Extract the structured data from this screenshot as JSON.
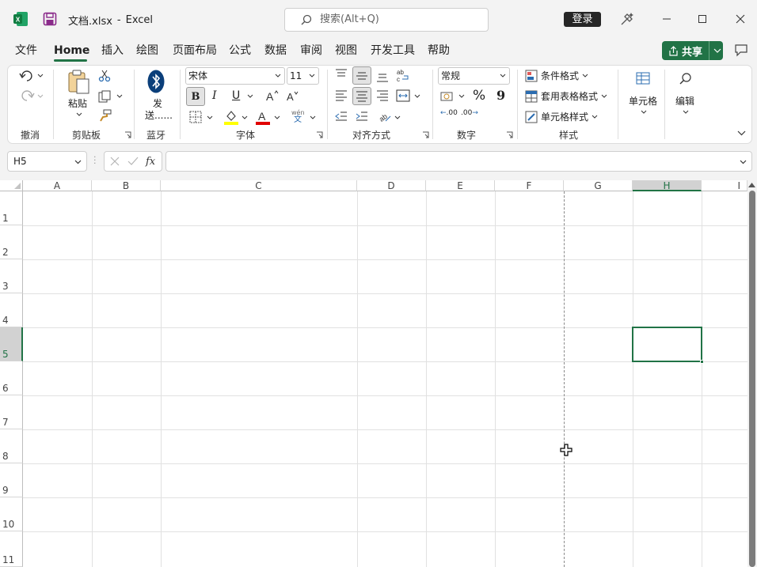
{
  "title": {
    "file_name": "文档.xlsx",
    "separator": "-",
    "app": "Excel"
  },
  "search": {
    "label": "搜索(Alt+Q)"
  },
  "login_label": "登录",
  "menu": [
    {
      "label": "文件"
    },
    {
      "label": "Home"
    },
    {
      "label": "插入"
    },
    {
      "label": "绘图"
    },
    {
      "label": "页面布局"
    },
    {
      "label": "公式"
    },
    {
      "label": "数据"
    },
    {
      "label": "审阅"
    },
    {
      "label": "视图"
    },
    {
      "label": "开发工具"
    },
    {
      "label": "帮助"
    }
  ],
  "share_label": "共享",
  "ribbon": {
    "undo_group": "撤消",
    "clipboard": {
      "paste": "粘贴",
      "group": "剪贴板"
    },
    "bluetooth": {
      "send_line1": "发",
      "send_line2": "送......",
      "group": "蓝牙"
    },
    "font": {
      "name": "宋体",
      "size": "11",
      "bold": "B",
      "italic": "I",
      "underline": "U",
      "phonetic_top": "wén",
      "phonetic_bottom": "文",
      "group": "字体"
    },
    "alignment": {
      "group": "对齐方式"
    },
    "number": {
      "format": "常规",
      "percent": "%",
      "comma": "9",
      "inc": ".00",
      "dec": ".00",
      "group": "数字"
    },
    "styles": {
      "conditional": "条件格式",
      "table": "套用表格格式",
      "cell": "单元格样式",
      "group": "样式"
    },
    "cells": {
      "label": "单元格"
    },
    "editing": {
      "label": "编辑"
    }
  },
  "formula_bar": {
    "name_box": "H5",
    "fx": "fx",
    "formula": ""
  },
  "grid": {
    "columns": [
      "A",
      "B",
      "C",
      "D",
      "E",
      "F",
      "G",
      "H",
      "I"
    ],
    "rows": [
      "1",
      "2",
      "3",
      "4",
      "5",
      "6",
      "7",
      "8",
      "9",
      "10",
      "11"
    ],
    "selected_cell": "H5"
  },
  "colors": {
    "accent": "#217346",
    "share_bg": "#217346",
    "selection": "#217346"
  }
}
